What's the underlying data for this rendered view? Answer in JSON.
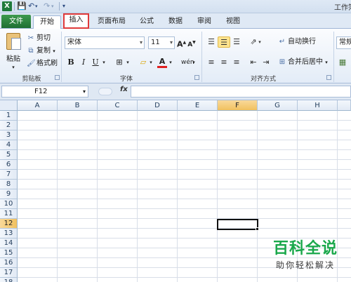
{
  "titlebar": {
    "app_icon": "X",
    "title": "工作簿"
  },
  "quick_access": {
    "save_icon": "save-icon",
    "undo_icon": "undo-icon",
    "redo_icon": "redo-icon"
  },
  "tabs": [
    {
      "label": "文件"
    },
    {
      "label": "开始"
    },
    {
      "label": "插入"
    },
    {
      "label": "页面布局"
    },
    {
      "label": "公式"
    },
    {
      "label": "数据"
    },
    {
      "label": "审阅"
    },
    {
      "label": "视图"
    }
  ],
  "ribbon": {
    "clipboard": {
      "paste": "粘贴",
      "cut": "剪切",
      "copy": "复制",
      "format_painter": "格式刷",
      "label": "剪贴板"
    },
    "font": {
      "name": "宋体",
      "size": "11",
      "bold": "B",
      "italic": "I",
      "underline": "U",
      "grow": "A",
      "shrink": "A",
      "font_color": "A",
      "label": "字体",
      "phonetic": "wén"
    },
    "alignment": {
      "wrap": "自动换行",
      "merge": "合并后居中",
      "label": "对齐方式"
    },
    "number": {
      "format": "常规"
    }
  },
  "formula_bar": {
    "name_box": "F12",
    "fx": "fx",
    "content": ""
  },
  "columns": [
    "A",
    "B",
    "C",
    "D",
    "E",
    "F",
    "G",
    "H"
  ],
  "rows": [
    "1",
    "2",
    "3",
    "4",
    "5",
    "6",
    "7",
    "8",
    "9",
    "10",
    "11",
    "12",
    "13",
    "14",
    "15",
    "16",
    "17",
    "18"
  ],
  "selected": {
    "column": "F",
    "row": "12"
  },
  "watermark": {
    "title": "百科全说",
    "subtitle": "助你轻松解决"
  },
  "colors": {
    "accent_green": "#1f7a3c",
    "highlight_red": "#e03a3a",
    "selection": "#f1c15f"
  }
}
